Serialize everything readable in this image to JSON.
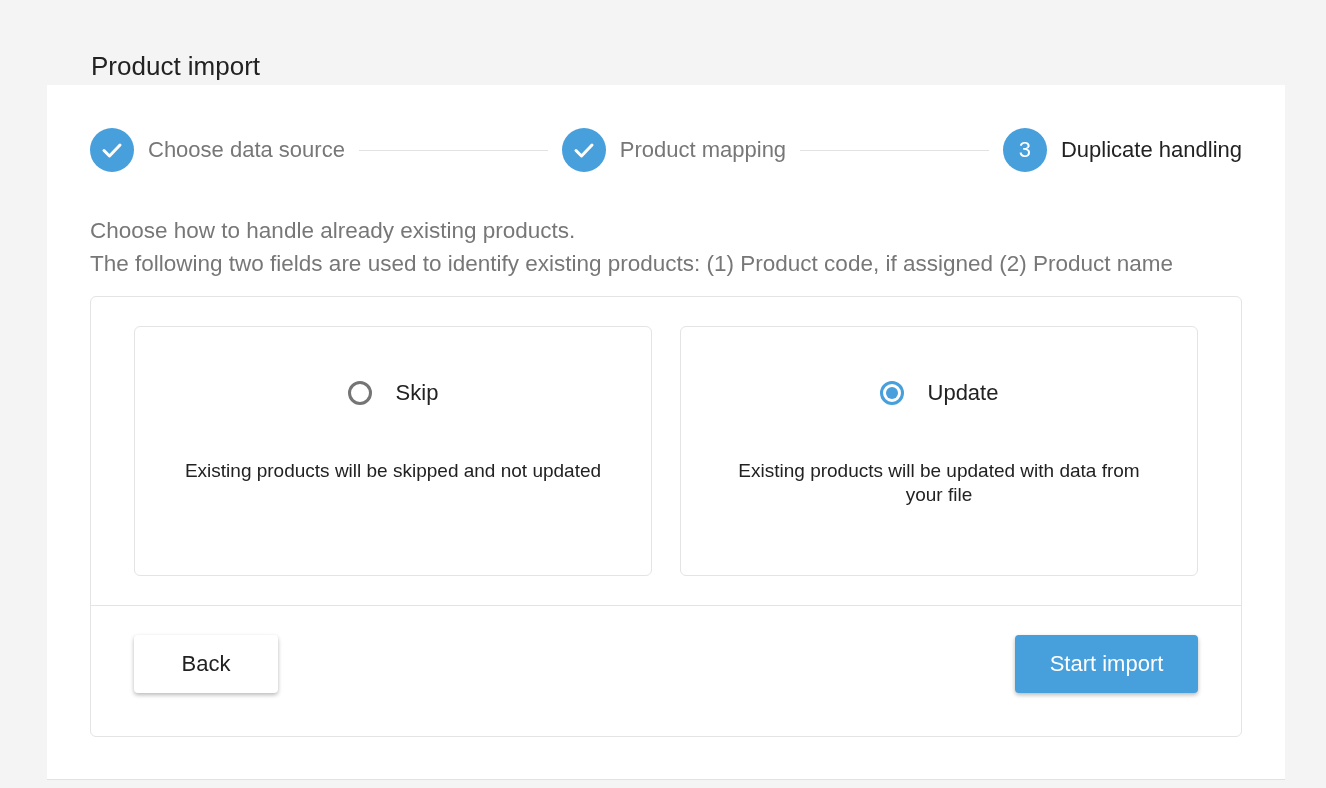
{
  "page": {
    "title": "Product import"
  },
  "steps": [
    {
      "label": "Choose data source",
      "completed": true,
      "current": false
    },
    {
      "label": "Product mapping",
      "completed": true,
      "current": false
    },
    {
      "number": "3",
      "label": "Duplicate handling",
      "completed": false,
      "current": true
    }
  ],
  "instructions": [
    "Choose how to handle already existing products.",
    "The following two fields are used to identify existing products: (1) Product code, if assigned (2) Product name"
  ],
  "options": [
    {
      "label": "Skip",
      "description": "Existing products will be skipped and not updated",
      "selected": false
    },
    {
      "label": "Update",
      "description": "Existing products will be updated with data from your file",
      "selected": true
    }
  ],
  "buttons": [
    {
      "label": "Back",
      "kind": "secondary"
    },
    {
      "label": "Start import",
      "kind": "primary"
    }
  ]
}
